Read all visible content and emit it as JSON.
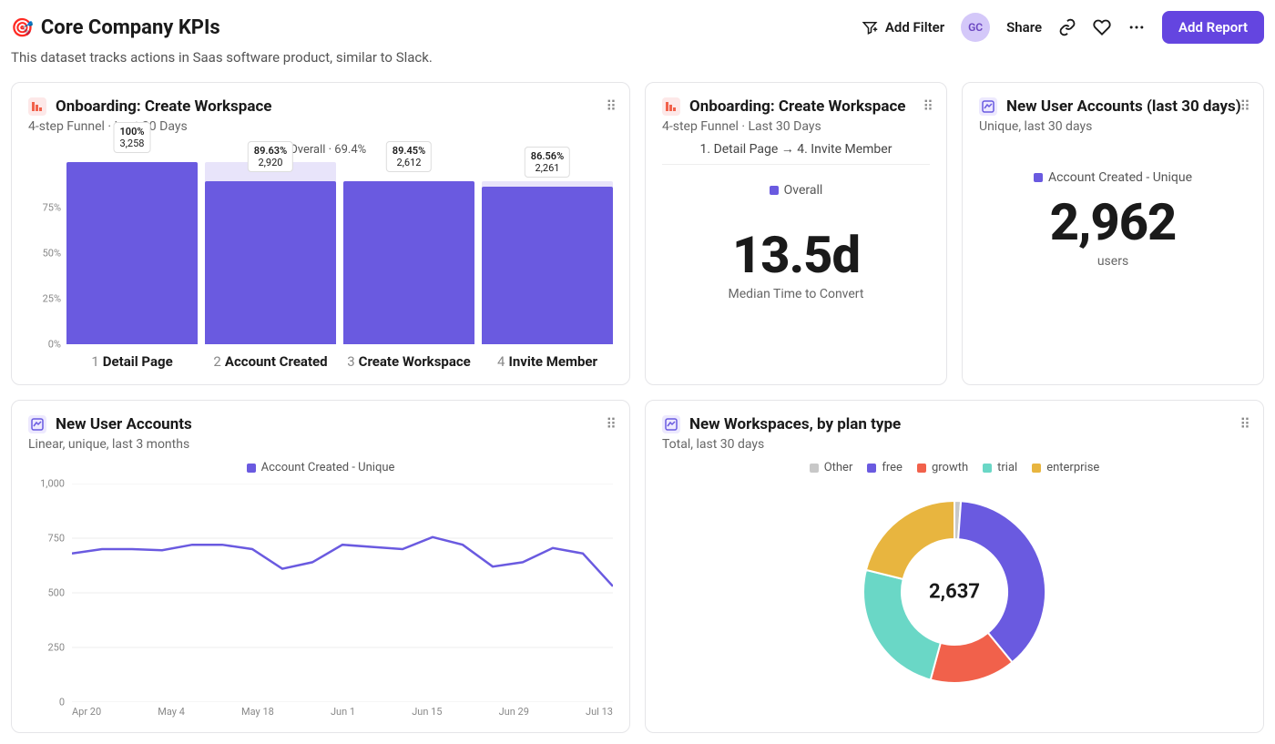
{
  "page": {
    "emoji": "🎯",
    "title": "Core Company KPIs",
    "subtitle": "This dataset tracks actions in Saas software product, similar to Slack."
  },
  "toolbar": {
    "add_filter": "Add Filter",
    "avatar": "GC",
    "share": "Share",
    "add_report": "Add Report"
  },
  "cards": {
    "funnel": {
      "title": "Onboarding: Create Workspace",
      "subtitle": "4-step Funnel · Last 30 Days",
      "legend": "Overall · 69.4%"
    },
    "convert": {
      "title": "Onboarding: Create Workspace",
      "subtitle": "4-step Funnel · Last 30 Days",
      "path": "1. Detail Page → 4. Invite Member",
      "legend": "Overall",
      "value": "13.5d",
      "value_sub": "Median Time to Convert"
    },
    "new_users_kpi": {
      "title": "New User Accounts (last 30 days)",
      "subtitle": "Unique, last 30 days",
      "legend": "Account Created - Unique",
      "value": "2,962",
      "value_sub": "users"
    },
    "new_users_line": {
      "title": "New User Accounts",
      "subtitle": "Linear, unique, last 3 months",
      "legend": "Account Created - Unique"
    },
    "workspaces": {
      "title": "New Workspaces, by plan type",
      "subtitle": "Total, last 30 days",
      "center": "2,637",
      "legend": {
        "other": "Other",
        "free": "free",
        "growth": "growth",
        "trial": "trial",
        "enterprise": "enterprise"
      }
    }
  },
  "chart_data": [
    {
      "id": "onboarding_funnel",
      "type": "bar",
      "title": "Onboarding: Create Workspace",
      "ylabel": "%",
      "ylim": [
        0,
        100
      ],
      "y_ticks": [
        "0%",
        "25%",
        "50%",
        "75%"
      ],
      "series_name": "Overall",
      "overall_conversion_pct": 69.4,
      "steps": [
        {
          "n": 1,
          "label": "Detail Page",
          "pct": 100,
          "count": 3258
        },
        {
          "n": 2,
          "label": "Account Created",
          "pct": 89.63,
          "count": 2920
        },
        {
          "n": 3,
          "label": "Create Workspace",
          "pct": 89.45,
          "count": 2612
        },
        {
          "n": 4,
          "label": "Invite Member",
          "pct": 86.56,
          "count": 2261
        }
      ]
    },
    {
      "id": "median_time_to_convert",
      "type": "scalar",
      "value": 13.5,
      "unit": "d",
      "label": "Median Time to Convert",
      "series_name": "Overall"
    },
    {
      "id": "new_user_accounts_30d",
      "type": "scalar",
      "value": 2962,
      "unit": "users",
      "label": "Account Created - Unique"
    },
    {
      "id": "new_user_accounts_line",
      "type": "line",
      "title": "New User Accounts",
      "ylabel": "",
      "ylim": [
        0,
        1000
      ],
      "y_ticks": [
        0,
        250,
        500,
        750,
        1000
      ],
      "x_ticks": [
        "Apr 20",
        "May 4",
        "May 18",
        "Jun 1",
        "Jun 15",
        "Jun 29",
        "Jul 13"
      ],
      "series": [
        {
          "name": "Account Created - Unique",
          "values": [
            680,
            700,
            700,
            695,
            720,
            720,
            700,
            610,
            640,
            720,
            710,
            700,
            755,
            720,
            620,
            640,
            705,
            680,
            530
          ]
        }
      ]
    },
    {
      "id": "workspaces_by_plan",
      "type": "pie",
      "title": "New Workspaces, by plan type",
      "total": 2637,
      "slices": [
        {
          "name": "Other",
          "value": 30,
          "color": "#c8c8c8"
        },
        {
          "name": "free",
          "value": 1000,
          "color": "#6a5ae0"
        },
        {
          "name": "growth",
          "value": 400,
          "color": "#f1614b"
        },
        {
          "name": "trial",
          "value": 650,
          "color": "#6ad7c6"
        },
        {
          "name": "enterprise",
          "value": 557,
          "color": "#e8b53f"
        }
      ]
    }
  ],
  "colors": {
    "primary": "#6a5ae0",
    "primary_light": "#e8e4fa",
    "other": "#c8c8c8",
    "free": "#6a5ae0",
    "growth": "#f1614b",
    "trial": "#6ad7c6",
    "enterprise": "#e8b53f"
  }
}
